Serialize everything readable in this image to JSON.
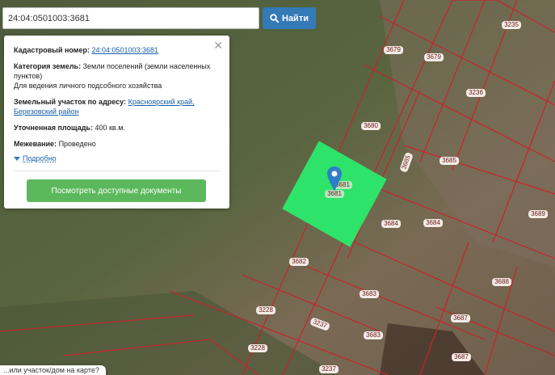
{
  "search": {
    "value": "24:04:0501003:3681",
    "button_label": "Найти"
  },
  "info": {
    "cadastral_label": "Кадастровый номер:",
    "cadastral_value": "24:04:0501003:3681",
    "category_label": "Категория земель:",
    "category_value": "Земли поселений (земли населенных пунктов)",
    "usage_value": "Для ведения личного подсобного хозяйства",
    "address_label": "Земельный участок по адресу:",
    "address_value": "Красноярский край, Березовский район",
    "area_label": "Уточненная площадь:",
    "area_value": "400 кв.м.",
    "survey_label": "Межевание:",
    "survey_value": "Проведено",
    "more_label": "Подробно",
    "docs_button": "Посмотреть доступные документы"
  },
  "map": {
    "selected_parcel_label": "3681",
    "selected_parcel_tag": "3681",
    "parcel_labels": [
      "3235",
      "3679",
      "3679",
      "3236",
      "3680",
      "3685",
      "3685",
      "3684",
      "3684",
      "3689",
      "3682",
      "3688",
      "3683",
      "3228",
      "3237",
      "3683",
      "3687",
      "3228",
      "3687",
      "3237"
    ],
    "colors": {
      "selected_fill": "#2ee36a",
      "boundary": "#c8232c",
      "label_text": "#6a1a1a"
    }
  },
  "bottom_hint": "...или участок/дом на карте?"
}
